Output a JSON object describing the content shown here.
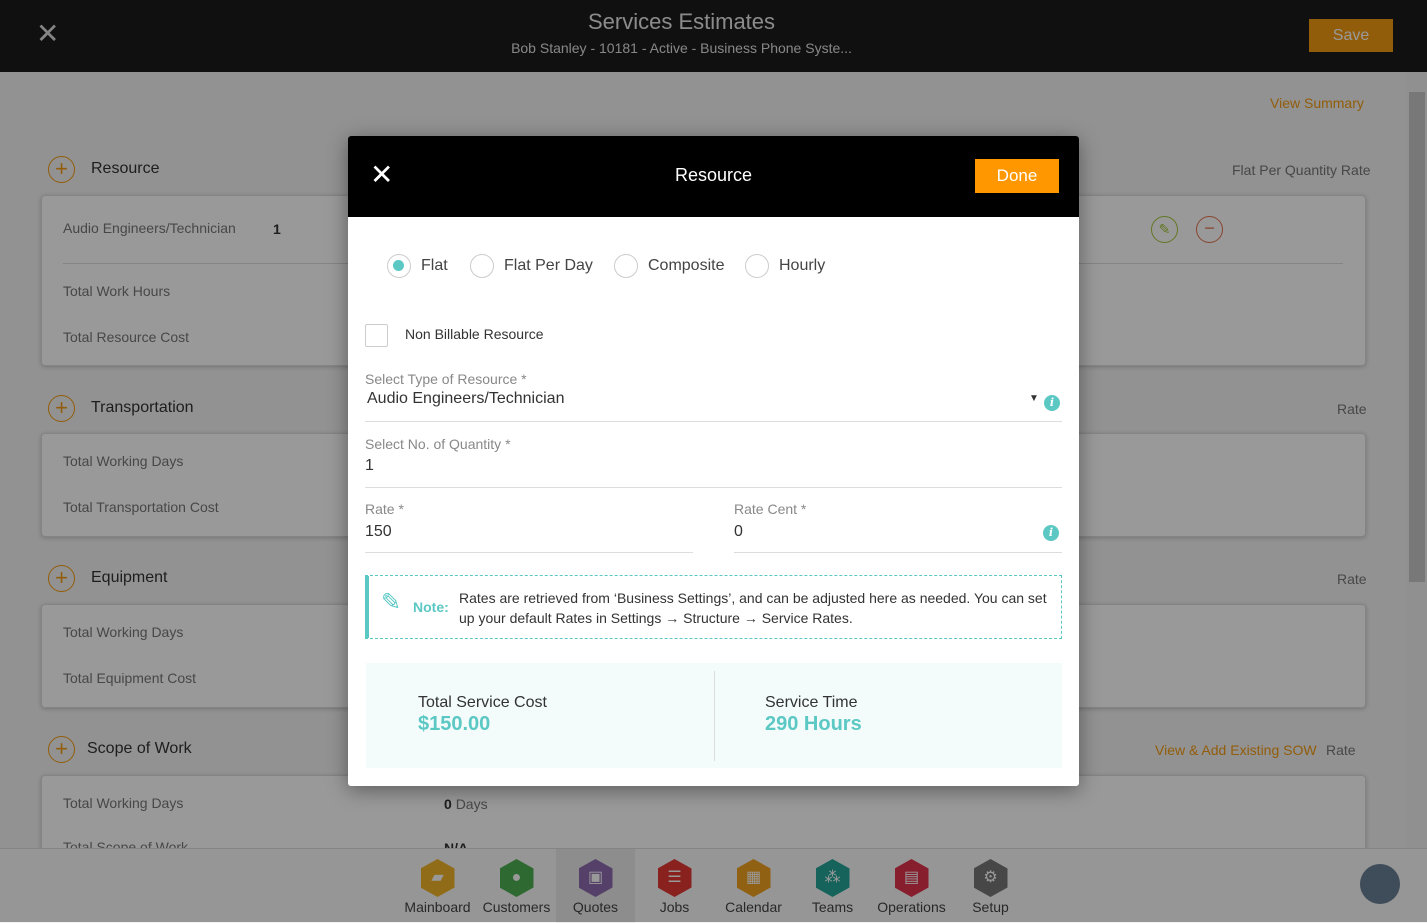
{
  "header": {
    "title": "Services Estimates",
    "subtitle": "Bob Stanley - 10181 - Active - Business Phone Syste...",
    "save": "Save",
    "close_icon": "close-icon"
  },
  "page": {
    "view_summary": "View Summary",
    "resource": {
      "title": "Resource",
      "rate_type": "Flat Per Quantity Rate",
      "item": "Audio Engineers/Technician",
      "qty": "1",
      "rows": [
        "Total Work Hours",
        "Total Resource Cost"
      ]
    },
    "transportation": {
      "title": "Transportation",
      "rate_type": "Rate",
      "rows": [
        "Total Working Days",
        "Total Transportation Cost"
      ]
    },
    "equipment": {
      "title": "Equipment",
      "rate_type": "Rate",
      "rows": [
        "Total Working Days",
        "Total Equipment Cost"
      ]
    },
    "sow": {
      "title": "Scope of Work",
      "link": "View & Add Existing SOW",
      "rate_type": "Rate",
      "rows": [
        "Total Working Days",
        "Total Scope of Work"
      ],
      "days_value": "0",
      "days_unit": "Days",
      "scope_value": "N/A"
    }
  },
  "nav": [
    {
      "label": "Mainboard",
      "color": "#f0b429"
    },
    {
      "label": "Customers",
      "color": "#4caf50"
    },
    {
      "label": "Quotes",
      "color": "#8e6bb0",
      "active": true
    },
    {
      "label": "Jobs",
      "color": "#e53935"
    },
    {
      "label": "Calendar",
      "color": "#f0a020"
    },
    {
      "label": "Teams",
      "color": "#26a69a"
    },
    {
      "label": "Operations",
      "color": "#e0334c"
    },
    {
      "label": "Setup",
      "color": "#777777"
    }
  ],
  "modal": {
    "title": "Resource",
    "done": "Done",
    "rate_options": [
      {
        "label": "Flat",
        "selected": true
      },
      {
        "label": "Flat Per Day"
      },
      {
        "label": "Composite"
      },
      {
        "label": "Hourly"
      }
    ],
    "non_billable": {
      "label": "Non Billable Resource",
      "checked": false
    },
    "type_label": "Select Type of Resource *",
    "type_value": "Audio Engineers/Technician",
    "qty_label": "Select No. of Quantity *",
    "qty_value": "1",
    "rate_label": "Rate *",
    "rate_value": "150",
    "cent_label": "Rate Cent *",
    "cent_value": "0",
    "note_label": "Note:",
    "note_text": "Rates are retrieved from ‘Business Settings’, and can be adjusted here as needed. You can set up your default Rates in Settings → Structure → Service Rates.",
    "total_cost_label": "Total Service Cost",
    "total_cost_value": "$150.00",
    "service_time_label": "Service Time",
    "service_time_value": "290 Hours"
  },
  "colors": {
    "accent": "#f39c12",
    "teal": "#5bc8c4"
  }
}
